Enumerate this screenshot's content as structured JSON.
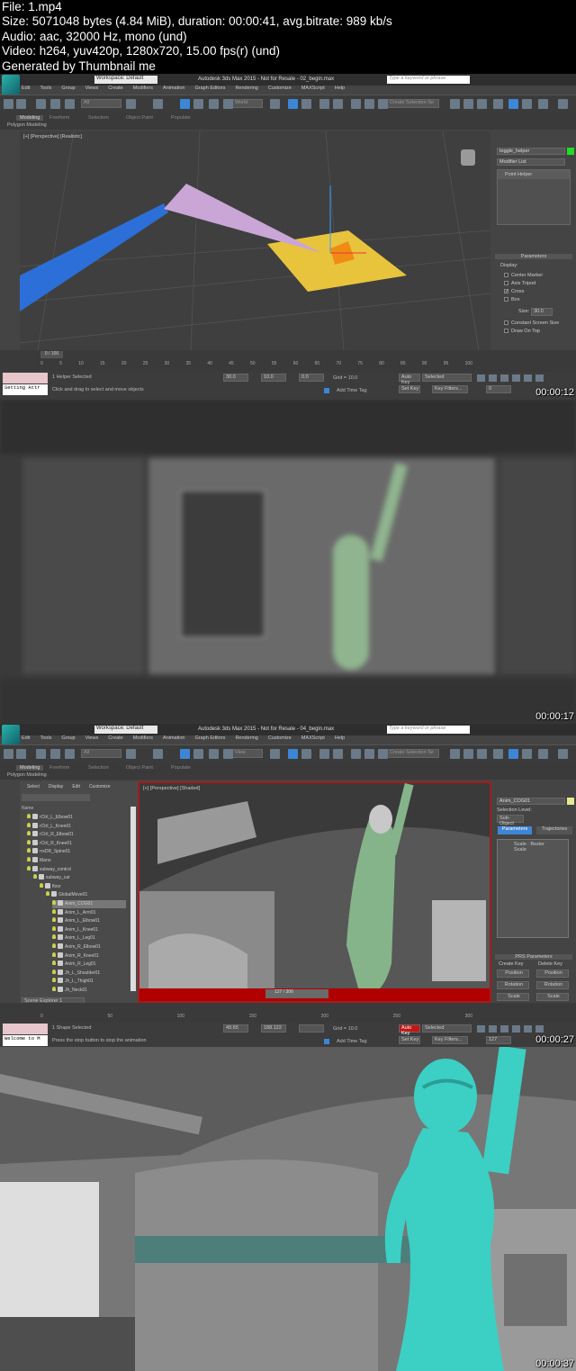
{
  "info": {
    "file": "File: 1.mp4",
    "size": "Size: 5071048 bytes (4.84 MiB), duration: 00:00:41, avg.bitrate: 989 kb/s",
    "audio": "Audio: aac, 32000 Hz, mono (und)",
    "video": "Video: h264, yuv420p, 1280x720, 15.00 fps(r) (und)",
    "generated": "Generated by Thumbnail me"
  },
  "menu": [
    "Edit",
    "Tools",
    "Group",
    "Views",
    "Create",
    "Modifiers",
    "Animation",
    "Graph Editors",
    "Rendering",
    "Customize",
    "MAXScript",
    "Help"
  ],
  "ribbon": {
    "tabs": [
      "Modeling",
      "Freeform",
      "Selection",
      "Object Paint",
      "Populate"
    ],
    "sub": "Polygon Modeling"
  },
  "search_placeholder": "Type a keyword or phrase",
  "workspace": "Workspace: Default",
  "filter_all": "All",
  "create_selection_set": "Create Selection Se",
  "frames": [
    {
      "timestamp": "00:00:12",
      "title": "Autodesk 3ds Max 2015 - Not for Resale - 02_begin.max",
      "coord_system": "World",
      "viewport_label": "[+] [Perspective] [Realistic]",
      "object_name": "toggle_helper",
      "object_color": "#22dd22",
      "modifier_list": "Modifier List",
      "stack_item": "Point Helper",
      "rollout_title": "Parameters",
      "display_group": "Display:",
      "options": [
        {
          "label": "Center Marker",
          "checked": false
        },
        {
          "label": "Axis Tripod",
          "checked": false
        },
        {
          "label": "Cross",
          "checked": true
        },
        {
          "label": "Box",
          "checked": false
        }
      ],
      "size_label": "Size:",
      "size_value": "30.0",
      "options2": [
        {
          "label": "Constant Screen Size",
          "checked": false
        },
        {
          "label": "Draw On Top",
          "checked": false
        }
      ],
      "time_slider": "0 / 100",
      "ticks": [
        "0",
        "5",
        "10",
        "15",
        "20",
        "25",
        "30",
        "35",
        "40",
        "45",
        "50",
        "55",
        "60",
        "65",
        "70",
        "75",
        "80",
        "85",
        "90",
        "95",
        "100"
      ],
      "listener": "Setting Attr",
      "selection_status": "1 Helper Selected",
      "prompt": "Click and drag to select and move objects",
      "x": "30.0",
      "y": "10.0",
      "z": "0.0",
      "grid": "Grid = 10.0",
      "add_time_tag": "Add Time Tag",
      "auto_key": "Auto Key",
      "set_key": "Set Key",
      "key_mode": "Selected",
      "key_filters": "Key Filters...",
      "frame": "0"
    },
    {
      "timestamp": "00:00:17"
    },
    {
      "timestamp": "00:00:27",
      "title": "Autodesk 3ds Max 2015 - Not for Resale - 04_begin.max",
      "coord_system": "View",
      "viewport_label": "[+] [Perspective] [Shaded]",
      "explorer_tabs": [
        "Select",
        "Display",
        "Edit",
        "Customize"
      ],
      "explorer_header": "Name",
      "tree": [
        {
          "name": "rCtrl_L_Elbow01",
          "depth": 0
        },
        {
          "name": "rCtrl_L_Knee01",
          "depth": 0
        },
        {
          "name": "rCtrl_R_Elbow01",
          "depth": 0
        },
        {
          "name": "rCtrl_R_Knee01",
          "depth": 0
        },
        {
          "name": "rrxDR_Spine01",
          "depth": 0
        },
        {
          "name": "Mano",
          "depth": 0
        },
        {
          "name": "subway_control",
          "depth": 0
        },
        {
          "name": "subway_car",
          "depth": 1
        },
        {
          "name": "floor",
          "depth": 2
        },
        {
          "name": "GlobalMove01",
          "depth": 3
        },
        {
          "name": "Anim_COG01",
          "depth": 4
        },
        {
          "name": "Anim_L_Arm01",
          "depth": 4
        },
        {
          "name": "Anim_L_Elbow01",
          "depth": 4
        },
        {
          "name": "Anim_L_Knee01",
          "depth": 4
        },
        {
          "name": "Anim_L_Leg01",
          "depth": 4
        },
        {
          "name": "Anim_R_Elbow01",
          "depth": 4
        },
        {
          "name": "Anim_R_Knee01",
          "depth": 4
        },
        {
          "name": "Anim_R_Leg01",
          "depth": 4
        },
        {
          "name": "Jh_L_Shoulder01",
          "depth": 4
        },
        {
          "name": "Jh_L_Thigh01",
          "depth": 4
        },
        {
          "name": "Jh_Neck01",
          "depth": 4
        }
      ],
      "scene_explorer": "Scene Explorer 1",
      "object_name": "Anim_COG01",
      "object_color": "#e8e890",
      "selection_level": "Selection Level:",
      "sub_object": "Sub-Object",
      "panel_tabs": [
        "Parameters",
        "Trajectories"
      ],
      "stack_item": "Scale : Bezier Scale",
      "prs_title": "PRS Parameters",
      "create_key": "Create Key",
      "delete_key": "Delete Key",
      "prs_buttons": [
        "Position",
        "Rotation",
        "Scale"
      ],
      "prs_modes": [
        "Position",
        "Rotation",
        "Scale"
      ],
      "time_slider": "127 / 306",
      "ticks": [
        "0",
        "50",
        "100",
        "150",
        "200",
        "250",
        "300"
      ],
      "listener": "Welcome to M",
      "selection_status": "1 Shape Selected",
      "prompt": "Press the stop button to stop the animation",
      "x": "49.65",
      "y": "188.122",
      "z": "",
      "grid": "Grid = 10.0",
      "add_time_tag": "Add Time Tag",
      "auto_key": "Auto Key",
      "set_key": "Set Key",
      "key_mode": "Selected",
      "key_filters": "Key Filters...",
      "frame": "127"
    },
    {
      "timestamp": "00:00:37"
    }
  ],
  "colors": {
    "accent": "#3d86d6",
    "autokey": "#c81414",
    "timeline_anim": "#b00000",
    "teal": "#3ccfc4"
  }
}
